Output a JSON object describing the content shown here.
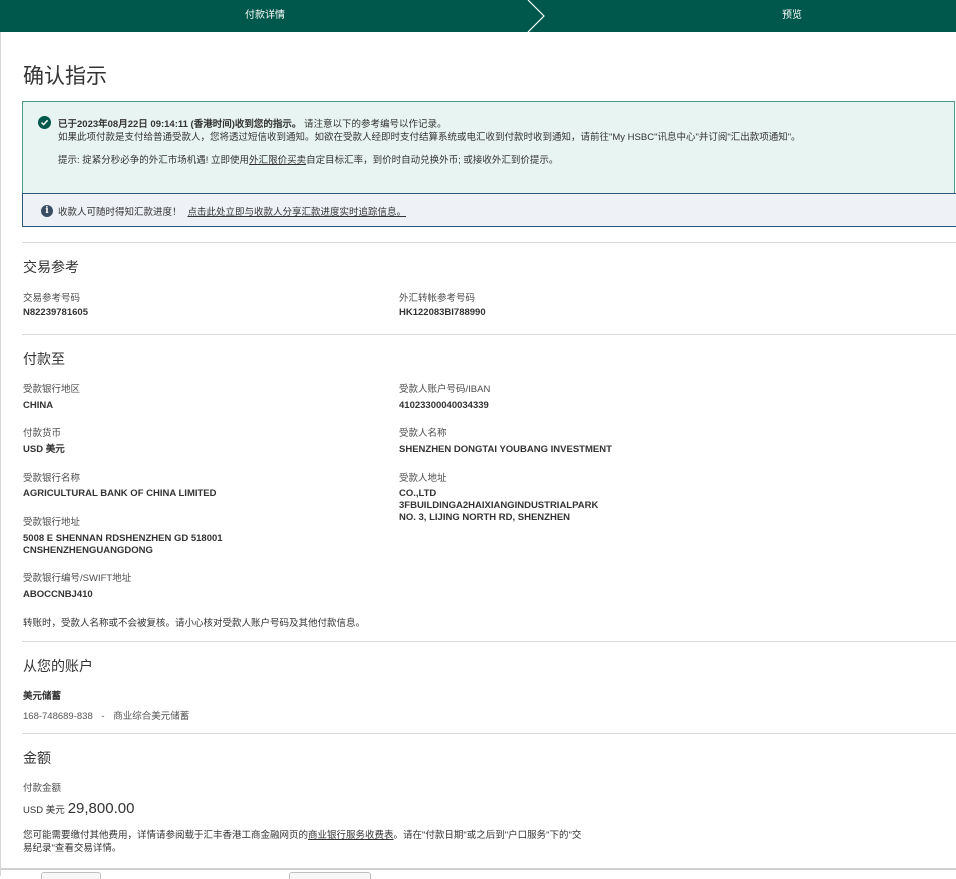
{
  "steps": {
    "current": "付款详情",
    "next": "预览"
  },
  "page_title": "确认指示",
  "success_notice": {
    "line1_strong": "已于2023年08月22日 09:14:11 (香港时间)收到您的指示。",
    "line1_rest": "请注意以下的参考编号以作记录。",
    "line2": "如果此项付款是支付给普通受款人，您将透过短信收到通知。如欲在受款人经即时支付结算系统或电汇收到付款时收到通知，请前往\"My HSBC\"讯息中心\"并订阅\"汇出款项通知\"。",
    "line3_pre": "提示: 掟紧分秒必争的外汇市场机遇! 立即使用",
    "line3_link": "外汇限价买卖",
    "line3_post": "自定目标汇率，到价时自动兑换外币; 或接收外汇到价提示。"
  },
  "info_notice": {
    "text": "收款人可随时得知汇款进度！",
    "link": "点击此处立即与收款人分享汇款进度实时追踪信息。"
  },
  "transaction_ref": {
    "title": "交易参考",
    "ref_label": "交易参考号码",
    "ref_value": "N82239781605",
    "fx_label": "外汇转帐参考号码",
    "fx_value": "HK122083BI788990"
  },
  "pay_to": {
    "title": "付款至",
    "bank_region_label": "受款银行地区",
    "bank_region": "CHINA",
    "currency_label": "付款货币",
    "currency": "USD 美元",
    "bank_name_label": "受款银行名称",
    "bank_name": "AGRICULTURAL BANK OF CHINA LIMITED",
    "bank_address_label": "受款银行地址",
    "bank_address_1": "5008 E SHENNAN RDSHENZHEN GD 518001",
    "bank_address_2": "CNSHENZHENGUANGDONG",
    "swift_label": "受款银行编号/SWIFT地址",
    "swift": "ABOCCNBJ410",
    "account_label": "受款人账户号码/IBAN",
    "account": "41023300040034339",
    "payee_name_label": "受款人名称",
    "payee_name": "SHENZHEN DONGTAI YOUBANG INVESTMENT",
    "payee_address_label": "受款人地址",
    "payee_address_1": "CO.,LTD",
    "payee_address_2": "3FBUILDINGA2HAIXIANGINDUSTRIALPARK",
    "payee_address_3": "NO. 3, LIJING NORTH RD, SHENZHEN",
    "warning": "转账时，受款人名称或不会被复核。请小心核对受款人账户号码及其他付款信息。"
  },
  "from_account": {
    "title": "从您的账户",
    "name": "美元储蓄",
    "number": "168-748689-838",
    "separator": "-",
    "type": "商业综合美元储蓄"
  },
  "amount": {
    "title": "金额",
    "label": "付款金额",
    "currency": "USD 美元",
    "value": "29,800.00",
    "note_pre": "您可能需要缴付其他费用，详情请参阅载于汇丰香港工商金融网页的",
    "note_link": "商业银行服务收费表",
    "note_post": "。请在\"付款日期\"或之后到\"户口服务\"下的\"交易纪录\"查看交易详情。"
  }
}
